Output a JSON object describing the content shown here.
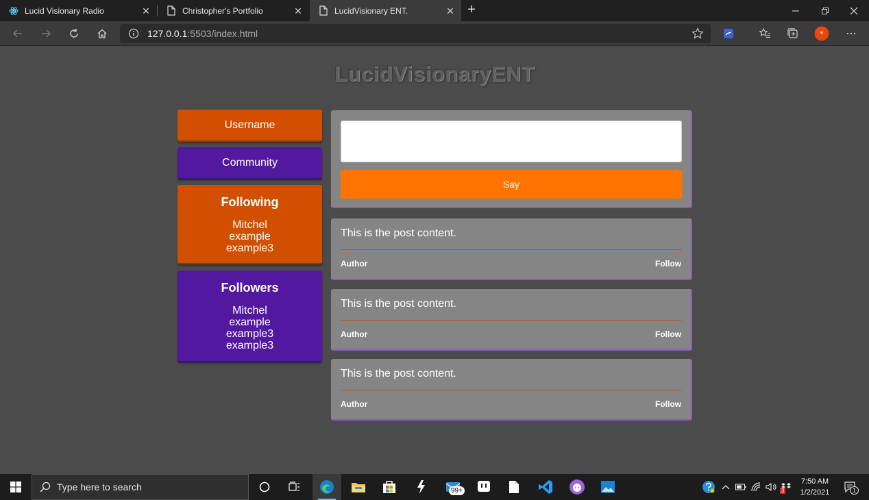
{
  "browser": {
    "tabs": [
      {
        "title": "Lucid Visionary Radio",
        "icon": "react-icon",
        "active": false
      },
      {
        "title": "Christopher's Portfolio",
        "icon": "page-icon",
        "active": false
      },
      {
        "title": "LucidVisionary ENT.",
        "icon": "page-icon",
        "active": true
      }
    ],
    "close_glyph": "✕",
    "new_tab_glyph": "+",
    "url_host": "127.0.0.1",
    "url_rest": ":5503/index.html"
  },
  "page": {
    "logo": "LucidVisionaryENT",
    "sidebar": {
      "username_label": "Username",
      "community_label": "Community",
      "following": {
        "heading": "Following",
        "names": [
          "Mitchel",
          "example",
          "example3"
        ]
      },
      "followers": {
        "heading": "Followers",
        "names": [
          "Mitchel",
          "example",
          "example3",
          "example3"
        ]
      }
    },
    "composer": {
      "input_value": "",
      "say_label": "Say"
    },
    "posts": [
      {
        "content": "This is the post content.",
        "author": "Author",
        "follow": "Follow"
      },
      {
        "content": "This is the post content.",
        "author": "Author",
        "follow": "Follow"
      },
      {
        "content": "This is the post content.",
        "author": "Author",
        "follow": "Follow"
      }
    ]
  },
  "taskbar": {
    "search_placeholder": "Type here to search",
    "mail_badge": "99+",
    "clock_time": "7:50 AM",
    "clock_date": "1/2/2021",
    "notification_count": "1",
    "dropbox_badge": "3"
  },
  "colors": {
    "orange_panel": "#d24f00",
    "purple_panel": "#5318a0",
    "say_button": "#ff7300",
    "post_bg": "#858585",
    "page_bg": "#4b4b4b"
  }
}
